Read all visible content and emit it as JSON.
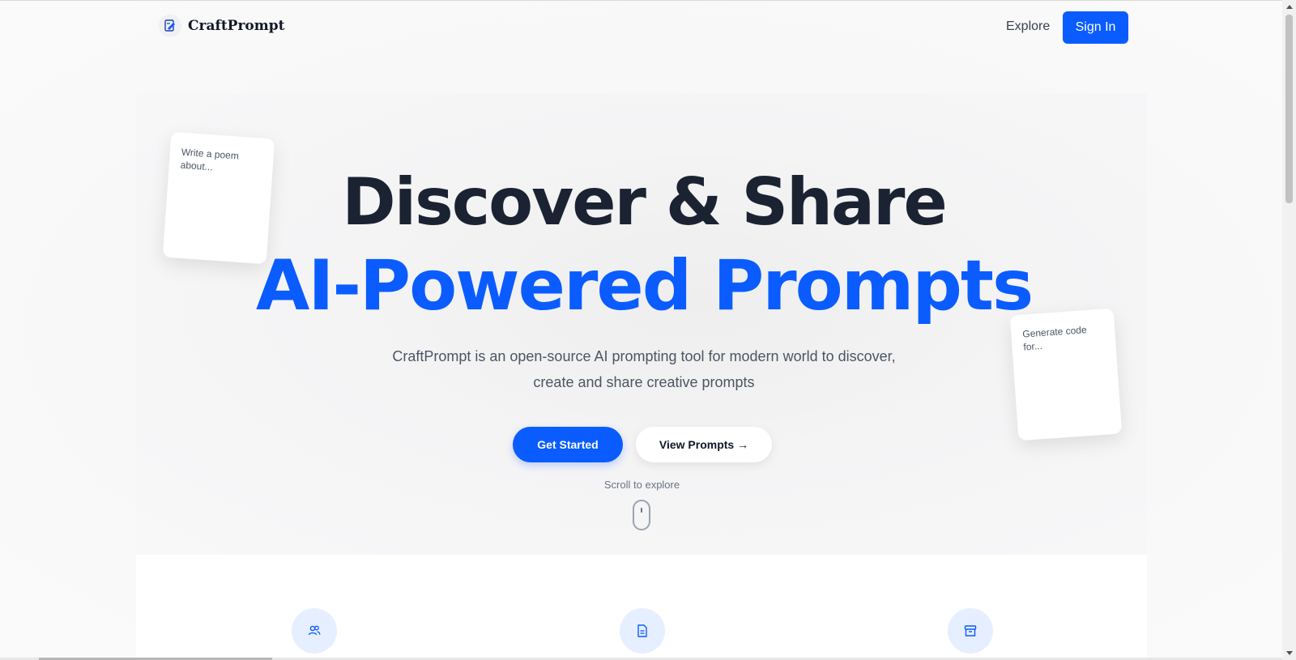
{
  "navbar": {
    "brand_name": "CraftPrompt",
    "logo_icon": "pen-note-icon",
    "explore_label": "Explore",
    "signin_label": "Sign In"
  },
  "hero": {
    "title_line1": "Discover & Share",
    "title_line2": "AI-Powered Prompts",
    "description": "CraftPrompt is an open-source AI prompting tool for modern world to discover, create and share creative prompts",
    "get_started_label": "Get Started",
    "view_prompts_label": "View Prompts →",
    "scroll_label": "Scroll to explore",
    "cards": [
      {
        "text": "Write a poem about..."
      },
      {
        "text": "Generate code for..."
      }
    ]
  },
  "features": {
    "icons": [
      "users-icon",
      "document-icon",
      "archive-icon"
    ]
  },
  "colors": {
    "accent": "#0a5cff",
    "heading": "#1b2333",
    "body_text": "#4b5563",
    "feature_icon_bg": "#e6efff"
  }
}
